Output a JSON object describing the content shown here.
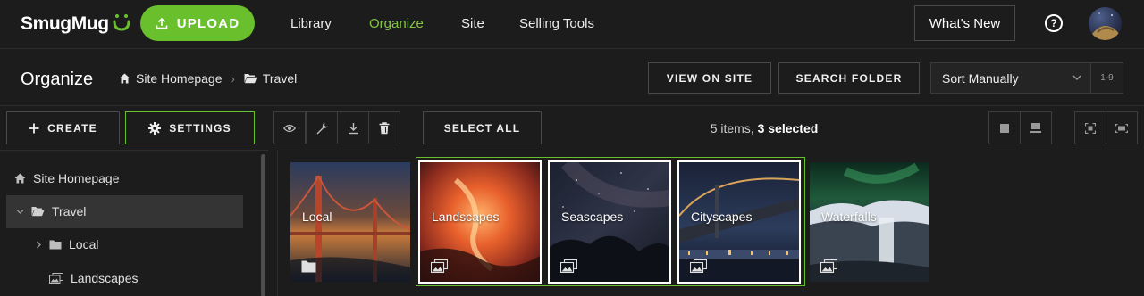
{
  "app": {
    "logo_text": "SmugMug",
    "brand_color": "#6abf2d"
  },
  "topnav": {
    "upload_label": "UPLOAD",
    "links": [
      {
        "label": "Library",
        "active": false
      },
      {
        "label": "Organize",
        "active": true
      },
      {
        "label": "Site",
        "active": false
      },
      {
        "label": "Selling Tools",
        "active": false
      }
    ],
    "whats_new_label": "What's New",
    "help_glyph": "?"
  },
  "subheader": {
    "title": "Organize",
    "breadcrumbs": [
      {
        "label": "Site Homepage",
        "icon": "home-icon"
      },
      {
        "label": "Travel",
        "icon": "folder-open-icon"
      }
    ],
    "view_on_site_label": "VIEW ON SITE",
    "search_folder_label": "SEARCH FOLDER",
    "sort_value": "Sort Manually",
    "range_label": "1-9"
  },
  "toolbar": {
    "create_label": "CREATE",
    "settings_label": "SETTINGS",
    "select_all_label": "SELECT ALL",
    "items_count": "5 items,",
    "selected_count": "3 selected",
    "icon_buttons": [
      "eye-icon",
      "wrench-icon",
      "download-icon",
      "trash-icon"
    ],
    "view_buttons": [
      "grid-view-icon",
      "list-view-icon",
      "fit-icon",
      "fill-icon"
    ]
  },
  "sidebar": {
    "items": [
      {
        "label": "Site Homepage",
        "icon": "home-icon"
      },
      {
        "label": "Travel",
        "icon": "folder-open-icon",
        "selected": true
      },
      {
        "label": "Local",
        "icon": "folder-icon"
      },
      {
        "label": "Landscapes",
        "icon": "gallery-icon"
      }
    ]
  },
  "grid": {
    "tiles": [
      {
        "label": "Local",
        "type": "folder",
        "selected": false
      },
      {
        "label": "Landscapes",
        "type": "gallery",
        "selected": true
      },
      {
        "label": "Seascapes",
        "type": "gallery",
        "selected": true
      },
      {
        "label": "Cityscapes",
        "type": "gallery",
        "selected": true
      },
      {
        "label": "Waterfalls",
        "type": "gallery",
        "selected": false
      }
    ]
  }
}
